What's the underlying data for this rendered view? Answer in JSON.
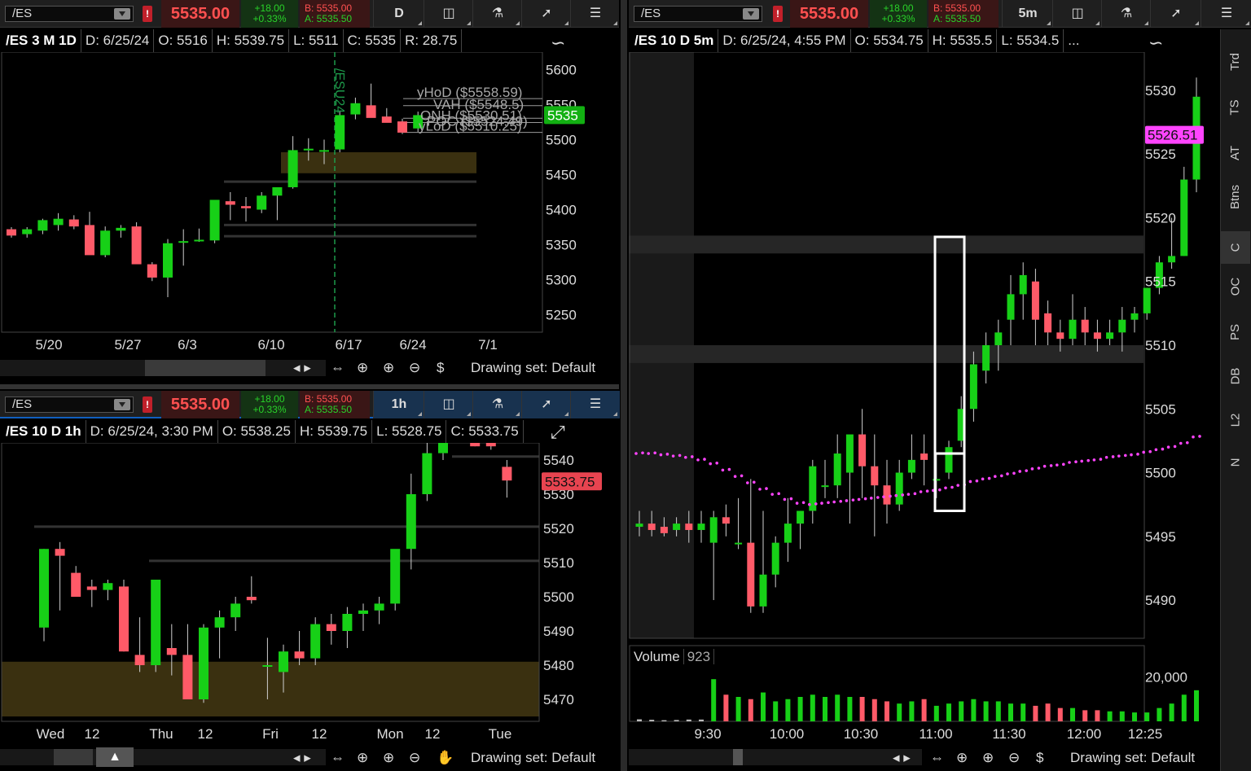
{
  "colors": {
    "up": "#17d017",
    "down": "#ff5a68",
    "bg": "#000000",
    "accent_magenta": "#ff44ff"
  },
  "p1": {
    "toolbar": {
      "symbol": "/ES",
      "price": "5535.00",
      "chg": "+18.00",
      "chg_pct": "+0.33%",
      "bid": "B: 5535.00",
      "ask": "A: 5535.50",
      "tf": "D"
    },
    "info": {
      "title": "/ES 3 M 1D",
      "d": "D: 6/25/24",
      "o": "O: 5516",
      "h": "H: 5539.75",
      "l": "L: 5511",
      "c": "C: 5535",
      "r": "R: 28.75"
    },
    "footer": {
      "drawing_set": "Drawing set: Default"
    },
    "current_label": "5535",
    "contract_label": "/ESU24",
    "level_labels": [
      "yHoD ($5558.59)",
      "VAH ($5548.5)",
      "ONH ($5530.51)",
      "yLoD ($5510.25)",
      "POC ($5524.49)"
    ]
  },
  "p2": {
    "toolbar": {
      "symbol": "/ES",
      "price": "5535.00",
      "chg": "+18.00",
      "chg_pct": "+0.33%",
      "bid": "B: 5535.00",
      "ask": "A: 5535.50",
      "tf": "1h"
    },
    "info": {
      "title": "/ES 10 D 1h",
      "d": "D: 6/25/24, 3:30 PM",
      "o": "O: 5538.25",
      "h": "H: 5539.75",
      "l": "L: 5528.75",
      "c": "C: 5533.75"
    },
    "footer": {
      "drawing_set": "Drawing set: Default"
    },
    "current_label": "5533.75"
  },
  "p3": {
    "toolbar": {
      "symbol": "/ES",
      "price": "5535.00",
      "chg": "+18.00",
      "chg_pct": "+0.33%",
      "bid": "B: 5535.00",
      "ask": "A: 5535.50",
      "tf": "5m"
    },
    "info": {
      "title": "/ES 10 D 5m",
      "d": "D: 6/25/24, 4:55 PM",
      "o": "O: 5534.75",
      "h": "H: 5535.5",
      "l": "L: 5534.5",
      "more": "..."
    },
    "footer": {
      "drawing_set": "Drawing set: Default"
    },
    "vwap_label": "5526.51",
    "volume": {
      "label": "Volume",
      "value": "923"
    },
    "side_tabs": [
      "Trd",
      "TS",
      "AT",
      "Btns",
      "C",
      "OC",
      "PS",
      "DB",
      "L2",
      "N"
    ]
  },
  "chart_data": [
    {
      "type": "candlestick",
      "title": "/ES 3 M 1D",
      "ylim": [
        5225,
        5625
      ],
      "yticks": [
        "5600",
        "5550",
        "5500",
        "5450",
        "5400",
        "5350",
        "5300",
        "5250"
      ],
      "xticks": [
        "5/20",
        "5/27",
        "6/3",
        "6/10",
        "6/17",
        "6/24",
        "7/1"
      ],
      "candles": [
        [
          5372,
          5375,
          5360,
          5363
        ],
        [
          5365,
          5375,
          5360,
          5372
        ],
        [
          5370,
          5387,
          5365,
          5385
        ],
        [
          5378,
          5395,
          5370,
          5387
        ],
        [
          5386,
          5392,
          5372,
          5376
        ],
        [
          5378,
          5397,
          5340,
          5335
        ],
        [
          5335,
          5376,
          5332,
          5370
        ],
        [
          5370,
          5378,
          5360,
          5374
        ],
        [
          5376,
          5382,
          5328,
          5322
        ],
        [
          5322,
          5325,
          5298,
          5303
        ],
        [
          5303,
          5358,
          5275,
          5352
        ],
        [
          5355,
          5372,
          5320,
          5355
        ],
        [
          5356,
          5373,
          5354,
          5357
        ],
        [
          5356,
          5410,
          5352,
          5414
        ],
        [
          5412,
          5425,
          5385,
          5407
        ],
        [
          5405,
          5418,
          5383,
          5402
        ],
        [
          5400,
          5425,
          5395,
          5420
        ],
        [
          5420,
          5432,
          5385,
          5432
        ],
        [
          5432,
          5505,
          5430,
          5485
        ],
        [
          5487,
          5502,
          5470,
          5487
        ],
        [
          5484,
          5500,
          5465,
          5485
        ],
        [
          5486,
          5540,
          5482,
          5535
        ],
        [
          5536,
          5560,
          5529,
          5552
        ],
        [
          5549,
          5580,
          5532,
          5531
        ],
        [
          5533,
          5545,
          5525,
          5524
        ],
        [
          5526,
          5530,
          5508,
          5510
        ],
        [
          5516,
          5540,
          5511,
          5535
        ]
      ],
      "levels": {
        "yHoD": 5558.59,
        "VAH": 5548.5,
        "ONH": 5530.51,
        "POC": 5524.49,
        "yLoD": 5510.25
      }
    },
    {
      "type": "candlestick",
      "title": "/ES 10 D 1h",
      "ylim": [
        5465,
        5545
      ],
      "yticks": [
        "5540",
        "5530",
        "5520",
        "5510",
        "5500",
        "5490",
        "5480",
        "5470"
      ],
      "xticks": [
        "Wed",
        "12",
        "Thu",
        "12",
        "Fri",
        "12",
        "Mon",
        "12",
        "Tue"
      ],
      "candles": [
        [
          5491,
          5514,
          5487,
          5514
        ],
        [
          5514,
          5516,
          5496,
          5512
        ],
        [
          5507,
          5509,
          5500,
          5500
        ],
        [
          5503,
          5505,
          5497,
          5502
        ],
        [
          5502,
          5505,
          5499,
          5504
        ],
        [
          5503,
          5505,
          5484,
          5484
        ],
        [
          5483,
          5494,
          5478,
          5480
        ],
        [
          5480,
          5505,
          5478,
          5505
        ],
        [
          5485,
          5492,
          5477,
          5483
        ],
        [
          5483,
          5492,
          5472,
          5470
        ],
        [
          5470,
          5492,
          5469,
          5491
        ],
        [
          5491,
          5496,
          5482,
          5494
        ],
        [
          5494,
          5500,
          5490,
          5498
        ],
        [
          5500,
          5506,
          5498,
          5499
        ],
        [
          5480,
          5488,
          5470,
          5480
        ],
        [
          5478,
          5486,
          5472,
          5484
        ],
        [
          5484,
          5490,
          5480,
          5482
        ],
        [
          5482,
          5494,
          5480,
          5492
        ],
        [
          5492,
          5495,
          5486,
          5490
        ],
        [
          5490,
          5497,
          5485,
          5495
        ],
        [
          5495,
          5498,
          5490,
          5496
        ],
        [
          5496,
          5500,
          5492,
          5498
        ],
        [
          5498,
          5513,
          5496,
          5514
        ],
        [
          5514,
          5536,
          5508,
          5530
        ],
        [
          5530,
          5545,
          5528,
          5542
        ],
        [
          5542,
          5552,
          5540,
          5550
        ],
        [
          5550,
          5551,
          5545,
          5547
        ],
        [
          5548,
          5549,
          5544,
          5544
        ],
        [
          5546,
          5548,
          5543,
          5544
        ],
        [
          5538,
          5540,
          5529,
          5534
        ]
      ]
    },
    {
      "type": "candlestick",
      "title": "/ES 10 D 5m",
      "ylim": [
        5487,
        5533
      ],
      "yticks": [
        "5530",
        "5525",
        "5520",
        "5515",
        "5510",
        "5505",
        "5500",
        "5495",
        "5490"
      ],
      "xticks": [
        "9:30",
        "10:00",
        "10:30",
        "11:00",
        "11:30",
        "12:00",
        "12:25"
      ],
      "candles": [
        [
          5495.75,
          5497,
          5495,
          5496
        ],
        [
          5496,
          5497,
          5495,
          5495.5
        ],
        [
          5495.75,
          5496.5,
          5495,
          5495.25
        ],
        [
          5495.5,
          5496.5,
          5495,
          5496
        ],
        [
          5496,
          5497,
          5494.5,
          5495.5
        ],
        [
          5495.5,
          5497,
          5494.5,
          5496
        ],
        [
          5494.5,
          5497,
          5490,
          5496.5
        ],
        [
          5496.5,
          5497.5,
          5495,
          5496
        ],
        [
          5494.5,
          5498,
          5494,
          5494.5
        ],
        [
          5494.5,
          5499.5,
          5489,
          5489.5
        ],
        [
          5489.5,
          5497,
          5489,
          5492
        ],
        [
          5492,
          5495,
          5491,
          5494.5
        ],
        [
          5494.5,
          5498,
          5493,
          5496
        ],
        [
          5496,
          5497,
          5494,
          5497
        ],
        [
          5497,
          5501,
          5496,
          5500.5
        ],
        [
          5499,
          5501,
          5498,
          5499
        ],
        [
          5499,
          5503,
          5498,
          5501.5
        ],
        [
          5500,
          5502.5,
          5496,
          5503
        ],
        [
          5503,
          5505,
          5498,
          5500.5
        ],
        [
          5500.5,
          5503,
          5495,
          5499
        ],
        [
          5499,
          5501,
          5496,
          5497.5
        ],
        [
          5497.5,
          5501,
          5497,
          5500
        ],
        [
          5500,
          5503,
          5499.5,
          5501
        ],
        [
          5501.5,
          5503,
          5499,
          5501
        ],
        [
          5499.5,
          5501.5,
          5498,
          5499.5
        ],
        [
          5500,
          5502.5,
          5499.5,
          5502
        ],
        [
          5502.5,
          5506,
          5502,
          5505
        ],
        [
          5505,
          5509.5,
          5504,
          5508.5
        ],
        [
          5508,
          5511,
          5507,
          5510
        ],
        [
          5510,
          5512,
          5508,
          5511
        ],
        [
          5512,
          5515.5,
          5510,
          5514
        ],
        [
          5514,
          5516.5,
          5512,
          5515.5
        ],
        [
          5515,
          5516,
          5510,
          5512
        ],
        [
          5512.5,
          5513.5,
          5510,
          5511
        ],
        [
          5511,
          5512,
          5509.5,
          5510.5
        ],
        [
          5510.5,
          5514,
          5510,
          5512
        ],
        [
          5512,
          5513,
          5510,
          5511
        ],
        [
          5511,
          5512,
          5509.5,
          5510.5
        ],
        [
          5510.5,
          5512,
          5510,
          5511
        ],
        [
          5511,
          5513,
          5509.5,
          5512
        ],
        [
          5512,
          5513,
          5511,
          5512.5
        ],
        [
          5512.5,
          5514.5,
          5512,
          5514.5
        ],
        [
          5514.5,
          5517,
          5514,
          5516.5
        ],
        [
          5516.5,
          5520,
          5516,
          5517
        ],
        [
          5517,
          5524,
          5517,
          5523
        ],
        [
          5523,
          5531,
          5522,
          5529.5
        ]
      ],
      "vwap": [
        5501.5,
        5501.5,
        5501.4,
        5501.3,
        5501.2,
        5501,
        5500.7,
        5500.2,
        5499.7,
        5499.2,
        5498.7,
        5498.3,
        5497.9,
        5497.6,
        5497.5,
        5497.6,
        5497.7,
        5497.8,
        5497.9,
        5498,
        5498.1,
        5498.2,
        5498.3,
        5498.5,
        5498.6,
        5498.8,
        5499,
        5499.3,
        5499.5,
        5499.7,
        5499.9,
        5500.1,
        5500.3,
        5500.5,
        5500.6,
        5500.8,
        5500.9,
        5501,
        5501.2,
        5501.3,
        5501.4,
        5501.6,
        5501.8,
        5502,
        5502.3,
        5502.8
      ],
      "volume": {
        "ylim": [
          0,
          22000
        ],
        "ytick": "20,000",
        "values": [
          900,
          700,
          500,
          600,
          800,
          800,
          19000,
          12000,
          11000,
          10000,
          13000,
          9000,
          10000,
          11000,
          12000,
          11000,
          12000,
          11000,
          11000,
          10000,
          9000,
          8000,
          9000,
          10000,
          7000,
          8000,
          9000,
          10000,
          9000,
          9000,
          8000,
          8000,
          7000,
          8000,
          6000,
          6000,
          5000,
          5000,
          4500,
          4500,
          4000,
          4000,
          6000,
          8000,
          12000,
          14000
        ]
      },
      "highlight_boxes": [
        {
          "t0": 5518.5,
          "t1": 5501.5,
          "index": 25
        },
        {
          "t0": 5501.5,
          "t1": 5497,
          "index": 25
        }
      ]
    }
  ]
}
